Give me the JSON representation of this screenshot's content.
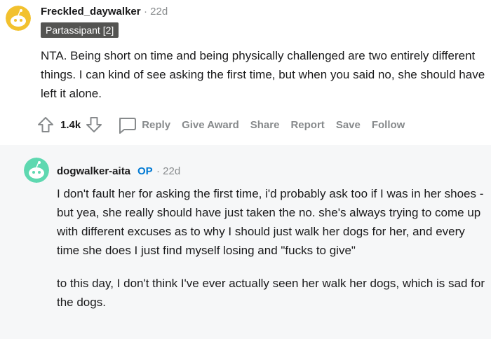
{
  "comments": [
    {
      "username": "Freckled_daywalker",
      "time": "22d",
      "flair": "Partassipant [2]",
      "body": "NTA. Being short on time and being physically challenged are two entirely different things. I can kind of see asking the first time, but when you said no, she should have left it alone.",
      "votes": "1.4k",
      "avatar_color": "#f2c12e",
      "actions": {
        "reply": "Reply",
        "give_award": "Give Award",
        "share": "Share",
        "report": "Report",
        "save": "Save",
        "follow": "Follow"
      },
      "icons": [
        "upvote-icon",
        "downvote-icon",
        "comment-icon"
      ]
    },
    {
      "username": "dogwalker-aita",
      "op_badge": "OP",
      "time": "22d",
      "paragraphs": [
        "I don't fault her for asking the first time, i'd probably ask too if I was in her shoes - but yea, she really should have just taken the no. she's always trying to come up with different excuses as to why I should just walk her dogs for her, and every time she does I just find myself losing and \"fucks to give\"",
        "to this day, I don't think I've ever actually seen her walk her dogs, which is sad for the dogs."
      ],
      "avatar_color": "#5ed8b0"
    }
  ],
  "separator": "·"
}
